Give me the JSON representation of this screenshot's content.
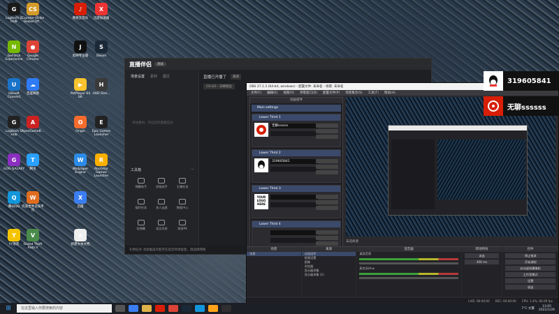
{
  "desktop": {
    "icons": [
      {
        "label": "Logitech G HUB",
        "color": "#1a1a1a",
        "glyph": "G"
      },
      {
        "label": "GeForce Experience",
        "color": "#76b900",
        "glyph": "N"
      },
      {
        "label": "Ubisoft Connect",
        "color": "#1a73c8",
        "glyph": "U"
      },
      {
        "label": "Logitech G Hub",
        "color": "#222",
        "glyph": "G"
      },
      {
        "label": "GOG GALAXY",
        "color": "#8a2fbf",
        "glyph": "G"
      },
      {
        "label": "腾讯QQ",
        "color": "#1296db",
        "glyph": "Q"
      },
      {
        "label": "YY语音",
        "color": "#f5c400",
        "glyph": "Y"
      },
      {
        "label": "Counter-Strike Global Off...",
        "color": "#d49a2a",
        "glyph": "CS"
      },
      {
        "label": "Google Chrome",
        "color": "#db4437",
        "glyph": "●"
      },
      {
        "label": "百度网盘",
        "color": "#2f7bf5",
        "glyph": "☁"
      },
      {
        "label": "ApexGameB...",
        "color": "#c22",
        "glyph": "A"
      },
      {
        "label": "腾讯",
        "color": "#2aa0ff",
        "glyph": "T"
      },
      {
        "label": "完美世界竞技平台",
        "color": "#e06d1f",
        "glyph": "W"
      },
      {
        "label": "Grand Theft Auto V",
        "color": "#4a8a4a",
        "glyph": "V"
      },
      {
        "label": "网易云音乐",
        "color": "#d81e06",
        "glyph": "♪"
      },
      {
        "label": "剪映专业版",
        "color": "#111",
        "glyph": "J"
      },
      {
        "label": "PotPlayer 64 bit",
        "color": "#f7c32e",
        "glyph": "▶"
      },
      {
        "label": "Origin",
        "color": "#f56c2d",
        "glyph": "O"
      },
      {
        "label": "Wallpaper Engine",
        "color": "#2b8be8",
        "glyph": "W"
      },
      {
        "label": "迅雷",
        "color": "#3a7ef2",
        "glyph": "X"
      },
      {
        "label": "新建文本文档",
        "color": "#eee",
        "glyph": "≡"
      },
      {
        "label": "迅游加速器",
        "color": "#e33",
        "glyph": "X"
      },
      {
        "label": "Steam",
        "color": "#1b2838",
        "glyph": "S"
      },
      {
        "label": "HUD Stre...",
        "color": "#3a3a3a",
        "glyph": "H"
      },
      {
        "label": "Epic Games Launcher",
        "color": "#222",
        "glyph": "E"
      },
      {
        "label": "Rockstar Games Launcher",
        "color": "#fbb000",
        "glyph": "R"
      }
    ]
  },
  "live_window": {
    "logo": "直播伴侣",
    "badge": "测试",
    "tabs": [
      "场景设置",
      "素材",
      "图文"
    ],
    "hint": "添加素材，开启您的直播互动",
    "center_title": "直播已开播了",
    "center_btn": "邀请",
    "game_tag": "CS:GO - 天梯排位",
    "tools_head": "工具箱",
    "tools": [
      "弹幕助手",
      "房管助手",
      "主播任务",
      "福利任务",
      "多人连麦",
      "数据中心",
      "贴弹幕",
      "语言风采",
      "跨屏PK",
      "",
      "",
      ""
    ],
    "status": "礼物任务   消息推送可能存在延迟并请留意，请选择网络"
  },
  "obs": {
    "title": "OBS 27.1.3 (64-bit, windows) - 配置文件: 未命名 - 场景: 未命名",
    "menu": [
      "文件(F)",
      "编辑(E)",
      "视图(V)",
      "停靠窗口(D)",
      "配置文件(P)",
      "场景集合(S)",
      "工具(T)",
      "帮助(H)"
    ],
    "lower_panel_head": "动画组件",
    "main_settings": "Main settings",
    "lower_thirds": [
      {
        "title": "Lower Third 1",
        "name": "无聊ssssss",
        "icon": "netease"
      },
      {
        "title": "Lower Third 2",
        "name": "319605841",
        "icon": "qq"
      },
      {
        "title": "Lower Third 3",
        "name": "",
        "icon": "logo"
      },
      {
        "title": "Lower Third 4",
        "name": "",
        "icon": "none"
      }
    ],
    "logo_text": "YOUR LOGO HERE",
    "preview_label": "未选择源",
    "docks": {
      "scenes": {
        "head": "场景",
        "items": [
          "场景"
        ]
      },
      "sources": {
        "head": "来源",
        "items": [
          "动画组件",
          "视频设置",
          "图像",
          "浏览器",
          "显示器采集",
          "显示器采集 (2)"
        ]
      },
      "mixer": {
        "head": "混音器",
        "items": [
          "桌面音频",
          "麦克风/Aux"
        ]
      },
      "transitions": {
        "head": "转场特效",
        "type": "淡出",
        "duration": "300 ms"
      },
      "controls": {
        "head": "控件",
        "buttons": [
          "停止推流",
          "开始录制",
          "启动虚拟摄像机",
          "工作室模式",
          "设置",
          "退出"
        ]
      }
    },
    "status": [
      "LIVE: 00:00:00",
      "REC: 00:00:00",
      "CPU: 1.4%, 60.00 fps"
    ]
  },
  "overlays": [
    {
      "text": "319605841",
      "icon": "qq"
    },
    {
      "text": "无聊ssssss",
      "icon": "netease"
    }
  ],
  "taskbar": {
    "search_placeholder": "在这里输入你要搜索的内容",
    "weather": "7°C 大雾",
    "time": "13:05",
    "date": "2022/1/26"
  }
}
